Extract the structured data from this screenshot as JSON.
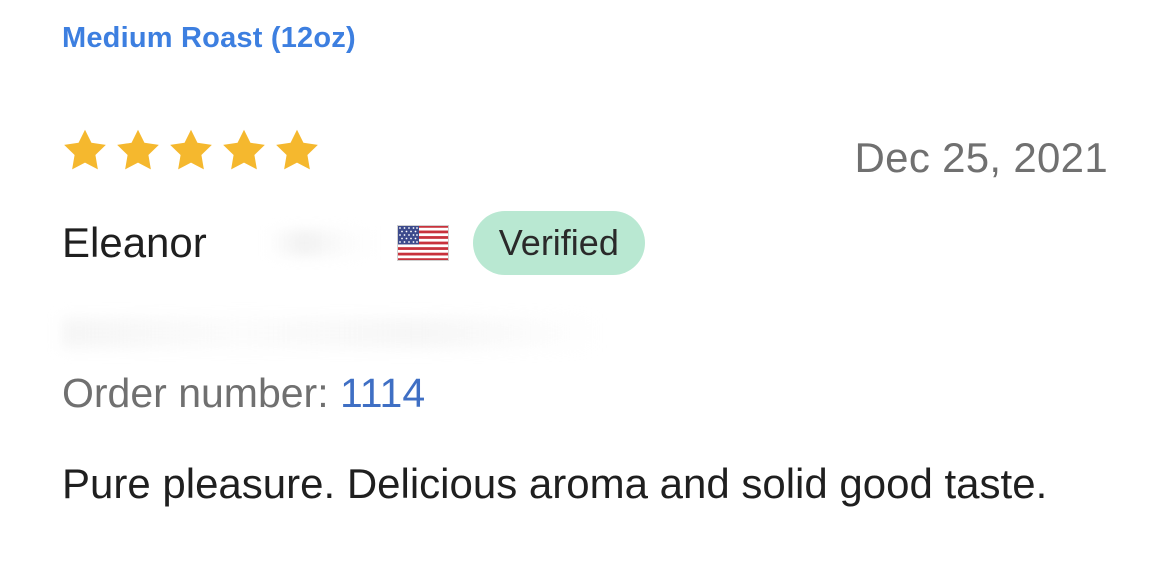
{
  "review": {
    "variant": "Medium Roast (12oz)",
    "rating": 5,
    "rating_max": 5,
    "date": "Dec 25, 2021",
    "author": "Eleanor",
    "country_flag_icon": "us-flag-icon",
    "verified_label": "Verified",
    "order_label": "Order number: ",
    "order_number": "1114",
    "text": "Pure pleasure. Delicious aroma and solid good taste."
  },
  "colors": {
    "variant_link": "#3d7fe0",
    "star": "#f5b82e",
    "badge_bg": "#b9e8d2",
    "order_number": "#3f6fc4",
    "muted_text": "#707070"
  }
}
